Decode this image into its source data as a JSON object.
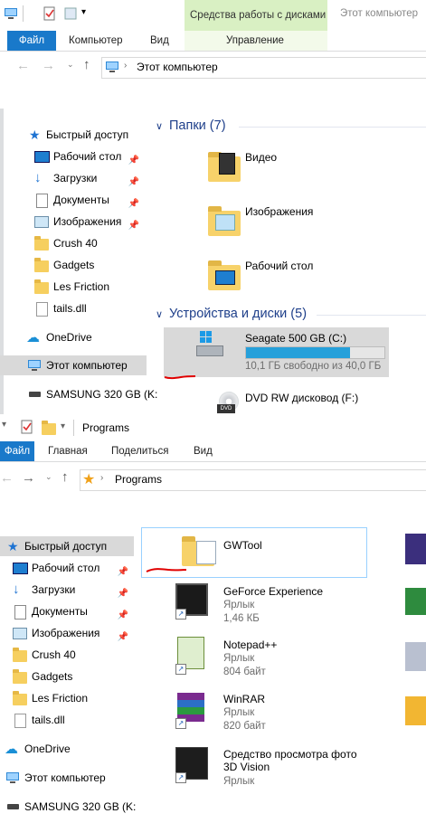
{
  "top_window": {
    "ribbon": {
      "contextual_tab_group": "Средства работы с дисками",
      "window_title": "Этот компьютер",
      "tabs": [
        "Файл",
        "Компьютер",
        "Вид",
        "Управление"
      ]
    },
    "address": {
      "path": "Этот компьютер"
    },
    "sidebar": {
      "quick_access": "Быстрый доступ",
      "items": [
        {
          "label": "Рабочий стол",
          "pinned": true
        },
        {
          "label": "Загрузки",
          "pinned": true
        },
        {
          "label": "Документы",
          "pinned": true
        },
        {
          "label": "Изображения",
          "pinned": true
        },
        {
          "label": "Crush 40",
          "pinned": false
        },
        {
          "label": "Gadgets",
          "pinned": false
        },
        {
          "label": "Les Friction",
          "pinned": false
        },
        {
          "label": "tails.dll",
          "pinned": false
        }
      ],
      "onedrive": "OneDrive",
      "this_pc": "Этот компьютер",
      "drive": "SAMSUNG 320 GB (K:"
    },
    "main": {
      "folders_header": "Папки (7)",
      "folders": [
        "Видео",
        "Изображения",
        "Рабочий стол"
      ],
      "devices_header": "Устройства и диски (5)",
      "drives": [
        {
          "name": "Seagate 500 GB (C:)",
          "free_text": "10,1 ГБ свободно из 40,0 ГБ",
          "used_fraction": 0.75
        },
        {
          "name": "DVD RW дисковод (F:)"
        }
      ]
    }
  },
  "bottom_window": {
    "title": "Programs",
    "ribbon": {
      "tabs": [
        "Файл",
        "Главная",
        "Поделиться",
        "Вид"
      ]
    },
    "address": {
      "path": "Programs"
    },
    "sidebar": {
      "quick_access": "Быстрый доступ",
      "items": [
        {
          "label": "Рабочий стол",
          "pinned": true
        },
        {
          "label": "Загрузки",
          "pinned": true
        },
        {
          "label": "Документы",
          "pinned": true
        },
        {
          "label": "Изображения",
          "pinned": true
        },
        {
          "label": "Crush 40",
          "pinned": false
        },
        {
          "label": "Gadgets",
          "pinned": false
        },
        {
          "label": "Les Friction",
          "pinned": false
        },
        {
          "label": "tails.dll",
          "pinned": false
        }
      ],
      "onedrive": "OneDrive",
      "this_pc": "Этот компьютер",
      "drive": "SAMSUNG 320 GB (K:"
    },
    "files": [
      {
        "name": "GWTool",
        "type": "",
        "size": ""
      },
      {
        "name": "GeForce Experience",
        "type": "Ярлык",
        "size": "1,46 КБ"
      },
      {
        "name": "Notepad++",
        "type": "Ярлык",
        "size": "804 байт"
      },
      {
        "name": "WinRAR",
        "type": "Ярлык",
        "size": "820 байт"
      },
      {
        "name": "Средство просмотра фото 3D Vision",
        "type": "Ярлык",
        "size": ""
      }
    ]
  },
  "colors": {
    "accent": "#1979ca",
    "selection": "#cce8ff",
    "selection_gray": "#d9d9d9",
    "drive_bar": "#26a0da",
    "annotation": "#e00000",
    "context_tab": "#d9f0c3"
  }
}
